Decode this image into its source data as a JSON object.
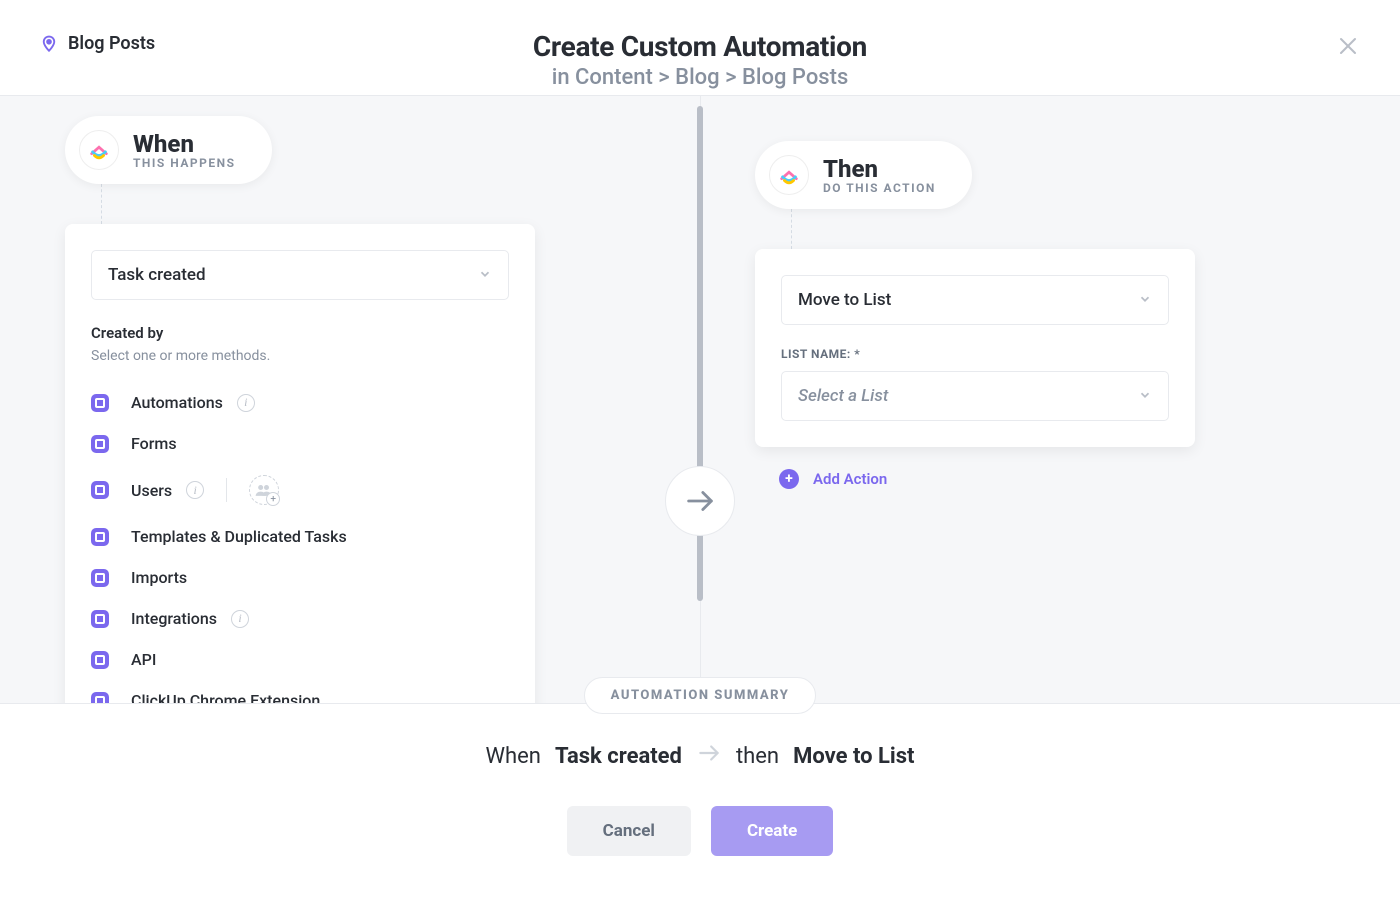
{
  "header": {
    "context_label": "Blog Posts",
    "title": "Create Custom Automation",
    "breadcrumb": "in Content > Blog > Blog Posts"
  },
  "when": {
    "pill_title": "When",
    "pill_sub": "THIS HAPPENS",
    "trigger_value": "Task created",
    "created_by_label": "Created by",
    "created_by_sub": "Select one or more methods.",
    "methods": [
      {
        "label": "Automations",
        "info": true
      },
      {
        "label": "Forms",
        "info": false
      },
      {
        "label": "Users",
        "info": true,
        "users": true
      },
      {
        "label": "Templates & Duplicated Tasks",
        "info": false
      },
      {
        "label": "Imports",
        "info": false
      },
      {
        "label": "Integrations",
        "info": true
      },
      {
        "label": "API",
        "info": false
      },
      {
        "label": "ClickUp Chrome Extension",
        "info": false
      }
    ]
  },
  "then": {
    "pill_title": "Then",
    "pill_sub": "DO THIS ACTION",
    "action_value": "Move to List",
    "field_label": "LIST NAME: *",
    "field_placeholder": "Select a List",
    "add_action": "Add Action"
  },
  "footer": {
    "badge": "AUTOMATION SUMMARY",
    "summary_when_prefix": "When",
    "summary_when_value": "Task created",
    "summary_then_prefix": "then",
    "summary_then_value": "Move to List",
    "cancel": "Cancel",
    "create": "Create"
  }
}
